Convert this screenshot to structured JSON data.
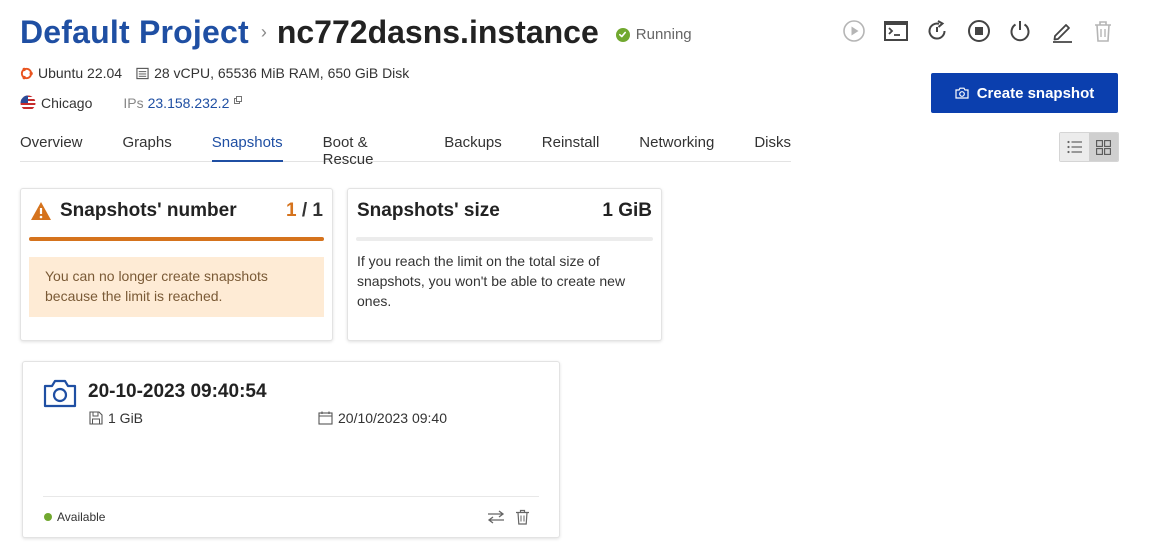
{
  "header": {
    "project": "Default Project",
    "separator": "›",
    "instance": "nc772dasns.instance",
    "status": "Running"
  },
  "meta": {
    "os": "Ubuntu 22.04",
    "specs": "28 vCPU, 65536 MiB RAM, 650 GiB Disk",
    "region": "Chicago",
    "ips_label": "IPs",
    "ip": "23.158.232.2"
  },
  "actions": [
    "play-icon",
    "console-icon",
    "restart-icon",
    "stop-icon",
    "power-icon",
    "edit-icon",
    "trash-icon"
  ],
  "create_button": "Create snapshot",
  "tabs": [
    "Overview",
    "Graphs",
    "Snapshots",
    "Boot & Rescue",
    "Backups",
    "Reinstall",
    "Networking",
    "Disks"
  ],
  "active_tab": "Snapshots",
  "limits": {
    "number": {
      "title": "Snapshots' number",
      "used": "1",
      "sep": " / ",
      "total": "1",
      "usage_fraction": 1.0,
      "warning": "You can no longer create snapshots because the limit is reached."
    },
    "size": {
      "title": "Snapshots' size",
      "value": "1 GiB",
      "usage_fraction": 0.0,
      "info": "If you reach the limit on the total size of snapshots, you won't be able to create new ones."
    }
  },
  "snapshot": {
    "title": "20-10-2023 09:40:54",
    "size": "1 GiB",
    "date": "20/10/2023 09:40",
    "status": "Available"
  },
  "colors": {
    "brand": "#1f4fa3",
    "button": "#0b3fae",
    "warning": "#d5731d",
    "success": "#71a82f",
    "warning_bg": "#feebd5"
  }
}
